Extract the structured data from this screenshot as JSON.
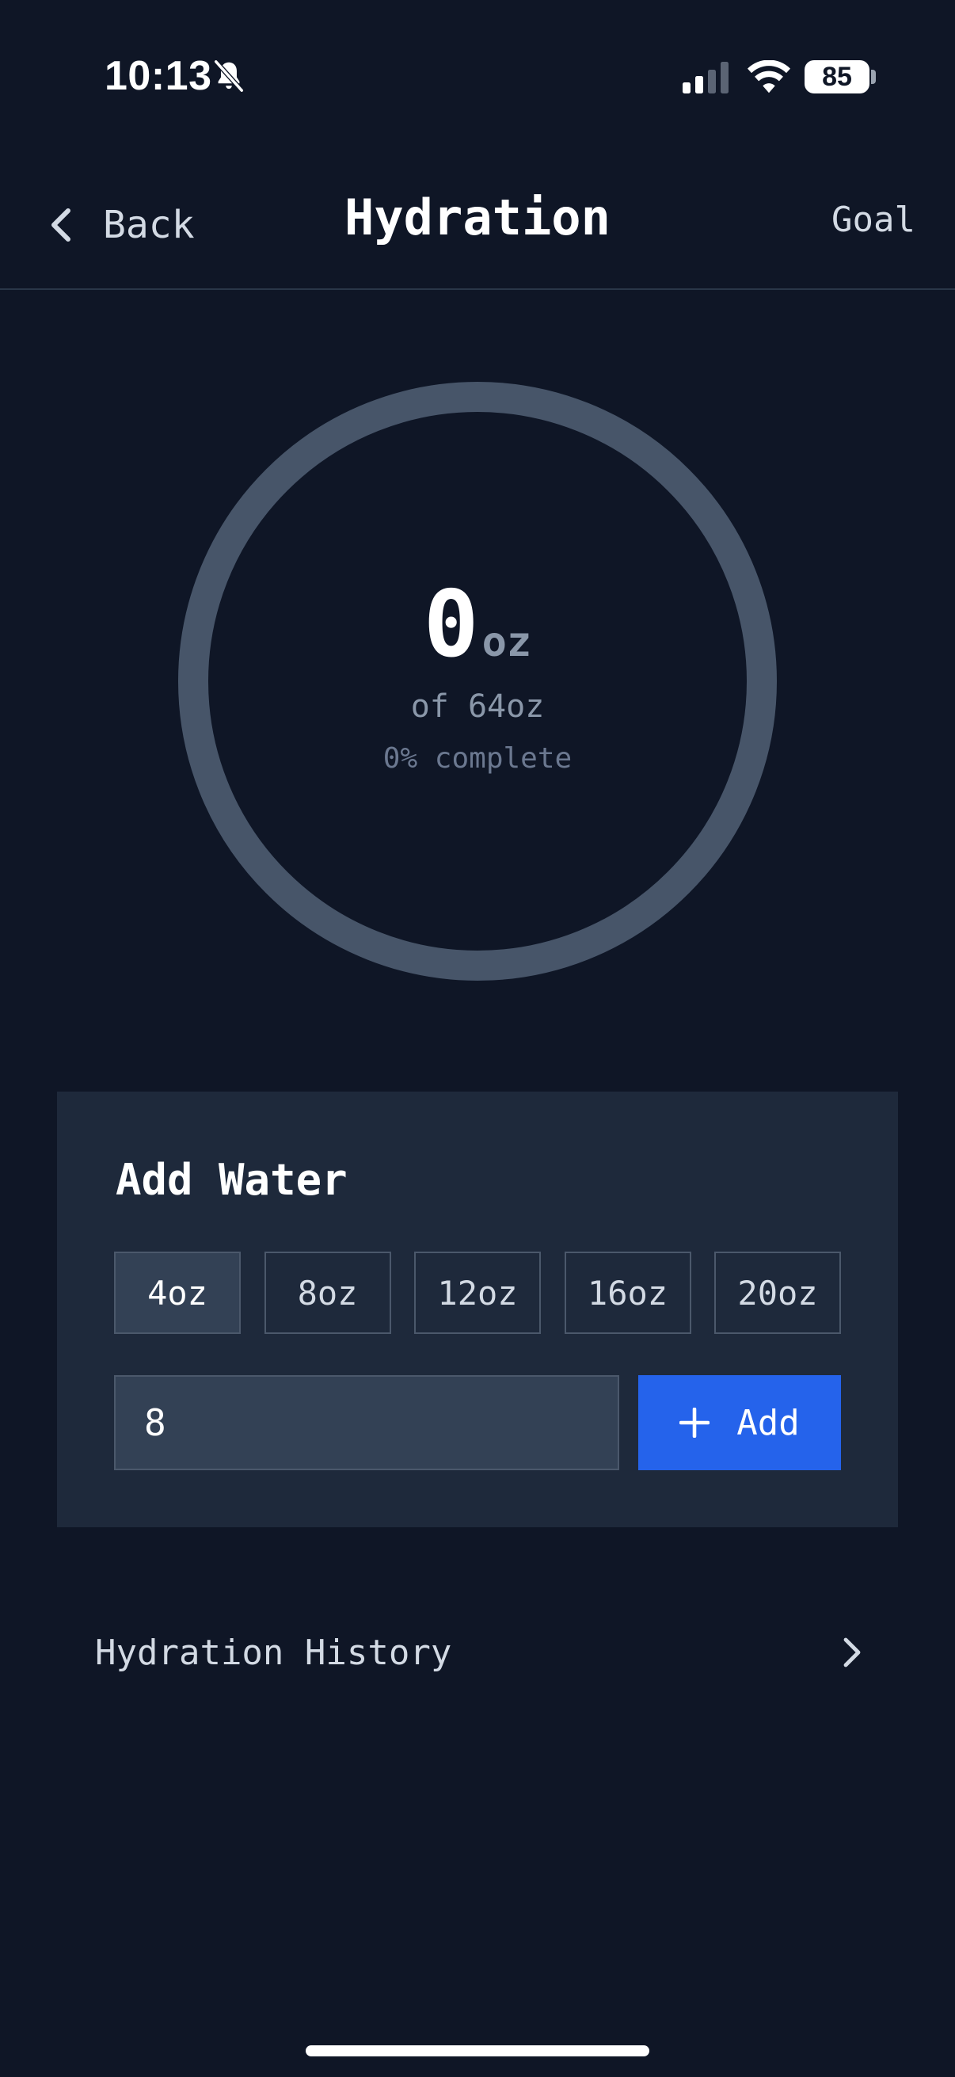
{
  "status_bar": {
    "time": "10:13",
    "battery": "85"
  },
  "nav": {
    "back_label": "Back",
    "title": "Hydration",
    "goal_label": "Goal"
  },
  "progress": {
    "amount": "0",
    "unit": "oz",
    "goal_text": "of 64oz",
    "percent_text": "0% complete",
    "fraction": 0,
    "track_color": "#475569",
    "fill_color": "#2563eb"
  },
  "add_water": {
    "title": "Add Water",
    "presets": [
      "4oz",
      "8oz",
      "12oz",
      "16oz",
      "20oz"
    ],
    "selected_preset": "4oz",
    "input_value": "8",
    "add_label": "Add",
    "accent_color": "#2563eb"
  },
  "history": {
    "label": "Hydration History"
  }
}
